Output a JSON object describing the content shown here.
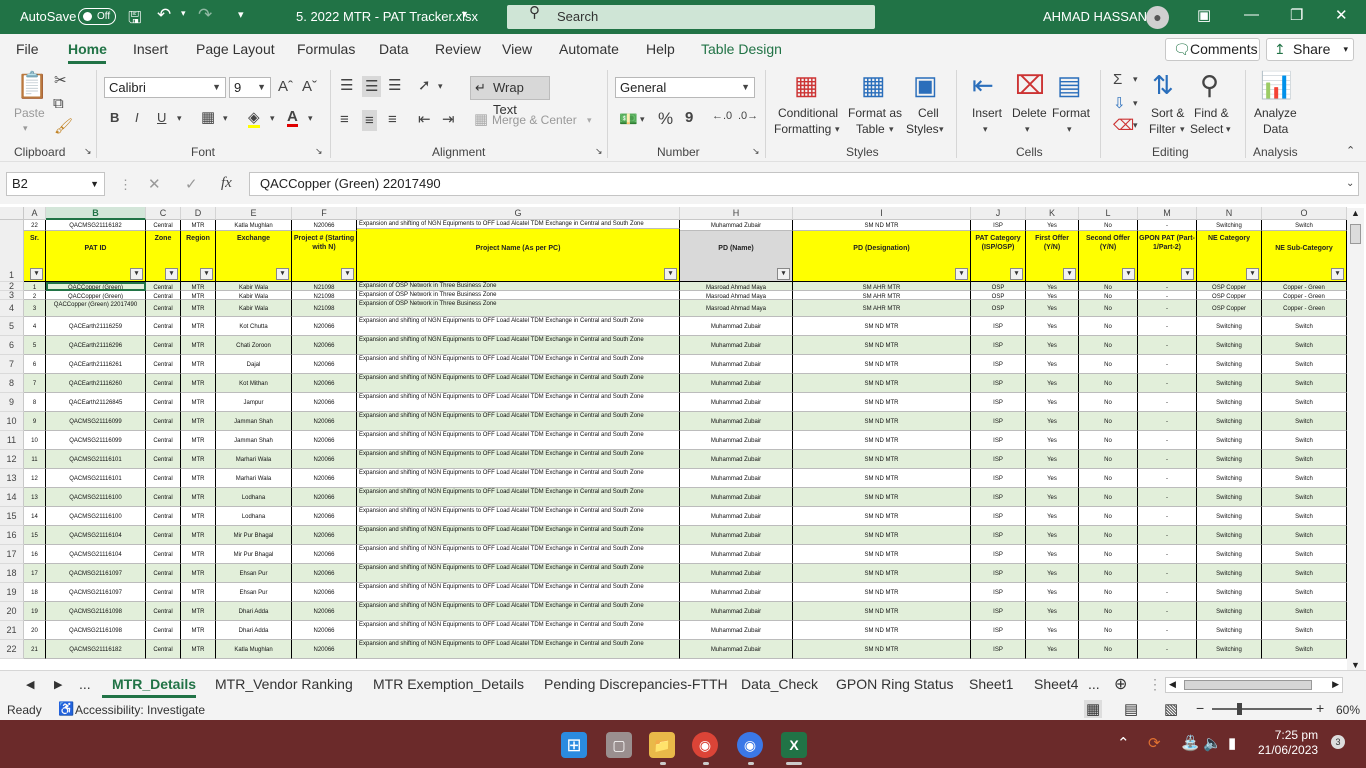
{
  "titlebar": {
    "autosave_label": "AutoSave",
    "autosave_state": "Off",
    "file_name": "5. 2022 MTR -  PAT Tracker.xlsx",
    "search_placeholder": "Search",
    "user_name": "AHMAD HASSAN"
  },
  "menu": {
    "items": [
      "File",
      "Home",
      "Insert",
      "Page Layout",
      "Formulas",
      "Data",
      "Review",
      "View",
      "Automate",
      "Help",
      "Table Design"
    ],
    "active": "Home",
    "comments_label": "Comments",
    "share_label": "Share"
  },
  "ribbon": {
    "clipboard": {
      "paste": "Paste",
      "group": "Clipboard"
    },
    "font": {
      "name": "Calibri",
      "size": "9",
      "group": "Font",
      "bold": "B",
      "italic": "I",
      "underline": "U"
    },
    "alignment": {
      "wrap": "Wrap Text",
      "merge": "Merge & Center",
      "group": "Alignment"
    },
    "number": {
      "format": "General",
      "group": "Number",
      "percent": "%",
      "comma": "9"
    },
    "styles": {
      "cond1": "Conditional",
      "cond2": "Formatting",
      "fmt1": "Format as",
      "fmt2": "Table",
      "cell1": "Cell",
      "cell2": "Styles",
      "group": "Styles"
    },
    "cells": {
      "insert": "Insert",
      "delete": "Delete",
      "format": "Format",
      "group": "Cells"
    },
    "editing": {
      "sort1": "Sort &",
      "sort2": "Filter",
      "find1": "Find &",
      "find2": "Select",
      "group": "Editing"
    },
    "analysis": {
      "a1": "Analyze",
      "a2": "Data",
      "group": "Analysis"
    }
  },
  "formula_bar": {
    "cell_ref": "B2",
    "formula": "QACCopper (Green) 22017490",
    "fx": "fx"
  },
  "columns": [
    {
      "letter": "A",
      "header": "Sr."
    },
    {
      "letter": "B",
      "header": "PAT ID"
    },
    {
      "letter": "C",
      "header": "Zone"
    },
    {
      "letter": "D",
      "header": "Region"
    },
    {
      "letter": "E",
      "header": "Exchange"
    },
    {
      "letter": "F",
      "header": "Project # (Starting with N)"
    },
    {
      "letter": "G",
      "header": "Project Name (As per PC)"
    },
    {
      "letter": "H",
      "header": "PD (Name)"
    },
    {
      "letter": "I",
      "header": "PD (Designation)"
    },
    {
      "letter": "J",
      "header": "PAT Category (ISP/OSP)"
    },
    {
      "letter": "K",
      "header": "First Offer (Y/N)"
    },
    {
      "letter": "L",
      "header": "Second Offer (Y/N)"
    },
    {
      "letter": "M",
      "header": "GPON PAT (Part-1/Part-2)"
    },
    {
      "letter": "N",
      "header": "NE Category"
    },
    {
      "letter": "O",
      "header": "NE Sub-Category"
    }
  ],
  "row_numbers": [
    "1",
    "2",
    "3",
    "4",
    "5",
    "6",
    "7",
    "8",
    "9",
    "10",
    "11",
    "12",
    "13",
    "14",
    "15",
    "16",
    "17",
    "18",
    "19",
    "20",
    "21",
    "22"
  ],
  "rows": [
    [
      "1",
      "QACCopper (Green)",
      "Central",
      "MTR",
      "Kabir Wala",
      "N21098",
      "Expansion of OSP Network in Three Business Zone",
      "Masroad Ahmad Maya",
      "SM AHR MTR",
      "OSP",
      "Yes",
      "No",
      "-",
      "OSP Copper",
      "Copper - Green"
    ],
    [
      "2",
      "QACCopper (Green)",
      "Central",
      "MTR",
      "Kabir Wala",
      "N21098",
      "Expansion of OSP Network in Three Business Zone",
      "Masroad Ahmad Maya",
      "SM AHR MTR",
      "OSP",
      "Yes",
      "No",
      "-",
      "OSP Copper",
      "Copper - Green"
    ],
    [
      "3",
      "QACCopper (Green) 22017490",
      "Central",
      "MTR",
      "Kabir Wala",
      "N21098",
      "Expansion of OSP Network in Three Business Zone",
      "Masroad Ahmad Maya",
      "SM AHR MTR",
      "OSP",
      "Yes",
      "No",
      "-",
      "OSP Copper",
      "Copper - Green"
    ],
    [
      "4",
      "QACEarth21116259",
      "Central",
      "MTR",
      "Kot Chutta",
      "N20066",
      "Expansion and shifting of NGN Equipments to OFF Load Alcatel TDM Exchange in Central and South Zone",
      "Muhammad Zubair",
      "SM ND MTR",
      "ISP",
      "Yes",
      "No",
      "-",
      "Switching",
      "Switch"
    ],
    [
      "5",
      "QACEarth21116296",
      "Central",
      "MTR",
      "Chati Zoroon",
      "N20066",
      "Expansion and shifting of NGN Equipments to OFF Load Alcatel TDM Exchange in Central and South Zone",
      "Muhammad Zubair",
      "SM ND MTR",
      "ISP",
      "Yes",
      "No",
      "-",
      "Switching",
      "Switch"
    ],
    [
      "6",
      "QACEarth21116261",
      "Central",
      "MTR",
      "Dajal",
      "N20066",
      "Expansion and shifting of NGN Equipments to OFF Load Alcatel TDM Exchange in Central and South Zone",
      "Muhammad Zubair",
      "SM ND MTR",
      "ISP",
      "Yes",
      "No",
      "-",
      "Switching",
      "Switch"
    ],
    [
      "7",
      "QACEarth21116260",
      "Central",
      "MTR",
      "Kot Mithan",
      "N20066",
      "Expansion and shifting of NGN Equipments to OFF Load Alcatel TDM Exchange in Central and South Zone",
      "Muhammad Zubair",
      "SM ND MTR",
      "ISP",
      "Yes",
      "No",
      "-",
      "Switching",
      "Switch"
    ],
    [
      "8",
      "QACEarth21126845",
      "Central",
      "MTR",
      "Jampur",
      "N20066",
      "Expansion and shifting of NGN Equipments to OFF Load Alcatel TDM Exchange in Central and South Zone",
      "Muhammad Zubair",
      "SM ND MTR",
      "ISP",
      "Yes",
      "No",
      "-",
      "Switching",
      "Switch"
    ],
    [
      "9",
      "QACMSG21116099",
      "Central",
      "MTR",
      "Jamman Shah",
      "N20066",
      "Expansion and shifting of NGN Equipments to OFF Load Alcatel TDM Exchange in Central and South Zone",
      "Muhammad Zubair",
      "SM ND MTR",
      "ISP",
      "Yes",
      "No",
      "-",
      "Switching",
      "Switch"
    ],
    [
      "10",
      "QACMSG21116099",
      "Central",
      "MTR",
      "Jamman Shah",
      "N20066",
      "Expansion and shifting of NGN Equipments to OFF Load Alcatel TDM Exchange in Central and South Zone",
      "Muhammad Zubair",
      "SM ND MTR",
      "ISP",
      "Yes",
      "No",
      "-",
      "Switching",
      "Switch"
    ],
    [
      "11",
      "QACMSG21116101",
      "Central",
      "MTR",
      "Marhari Wala",
      "N20066",
      "Expansion and shifting of NGN Equipments to OFF Load Alcatel TDM Exchange in Central and South Zone",
      "Muhammad Zubair",
      "SM ND MTR",
      "ISP",
      "Yes",
      "No",
      "-",
      "Switching",
      "Switch"
    ],
    [
      "12",
      "QACMSG21116101",
      "Central",
      "MTR",
      "Marhari Wala",
      "N20066",
      "Expansion and shifting of NGN Equipments to OFF Load Alcatel TDM Exchange in Central and South Zone",
      "Muhammad Zubair",
      "SM ND MTR",
      "ISP",
      "Yes",
      "No",
      "-",
      "Switching",
      "Switch"
    ],
    [
      "13",
      "QACMSG21116100",
      "Central",
      "MTR",
      "Lodhana",
      "N20066",
      "Expansion and shifting of NGN Equipments to OFF Load Alcatel TDM Exchange in Central and South Zone",
      "Muhammad Zubair",
      "SM ND MTR",
      "ISP",
      "Yes",
      "No",
      "-",
      "Switching",
      "Switch"
    ],
    [
      "14",
      "QACMSG21116100",
      "Central",
      "MTR",
      "Lodhana",
      "N20066",
      "Expansion and shifting of NGN Equipments to OFF Load Alcatel TDM Exchange in Central and South Zone",
      "Muhammad Zubair",
      "SM ND MTR",
      "ISP",
      "Yes",
      "No",
      "-",
      "Switching",
      "Switch"
    ],
    [
      "15",
      "QACMSG21116104",
      "Central",
      "MTR",
      "Mir Pur Bhagal",
      "N20066",
      "Expansion and shifting of NGN Equipments to OFF Load Alcatel TDM Exchange in Central and South Zone",
      "Muhammad Zubair",
      "SM ND MTR",
      "ISP",
      "Yes",
      "No",
      "-",
      "Switching",
      "Switch"
    ],
    [
      "16",
      "QACMSG21116104",
      "Central",
      "MTR",
      "Mir Pur Bhagal",
      "N20066",
      "Expansion and shifting of NGN Equipments to OFF Load Alcatel TDM Exchange in Central and South Zone",
      "Muhammad Zubair",
      "SM ND MTR",
      "ISP",
      "Yes",
      "No",
      "-",
      "Switching",
      "Switch"
    ],
    [
      "17",
      "QACMSG21161097",
      "Central",
      "MTR",
      "Ehsan Pur",
      "N20066",
      "Expansion and shifting of NGN Equipments to OFF Load Alcatel TDM Exchange in Central and South Zone",
      "Muhammad Zubair",
      "SM ND MTR",
      "ISP",
      "Yes",
      "No",
      "-",
      "Switching",
      "Switch"
    ],
    [
      "18",
      "QACMSG21161097",
      "Central",
      "MTR",
      "Ehsan Pur",
      "N20066",
      "Expansion and shifting of NGN Equipments to OFF Load Alcatel TDM Exchange in Central and South Zone",
      "Muhammad Zubair",
      "SM ND MTR",
      "ISP",
      "Yes",
      "No",
      "-",
      "Switching",
      "Switch"
    ],
    [
      "19",
      "QACMSG21161098",
      "Central",
      "MTR",
      "Dhari Adda",
      "N20066",
      "Expansion and shifting of NGN Equipments to OFF Load Alcatel TDM Exchange in Central and South Zone",
      "Muhammad Zubair",
      "SM ND MTR",
      "ISP",
      "Yes",
      "No",
      "-",
      "Switching",
      "Switch"
    ],
    [
      "20",
      "QACMSG21161098",
      "Central",
      "MTR",
      "Dhari Adda",
      "N20066",
      "Expansion and shifting of NGN Equipments to OFF Load Alcatel TDM Exchange in Central and South Zone",
      "Muhammad Zubair",
      "SM ND MTR",
      "ISP",
      "Yes",
      "No",
      "-",
      "Switching",
      "Switch"
    ],
    [
      "21",
      "QACMSG21116182",
      "Central",
      "MTR",
      "Katla Mughlan",
      "N20066",
      "Expansion and shifting of NGN Equipments to OFF Load Alcatel TDM Exchange in Central and South Zone",
      "Muhammad Zubair",
      "SM ND MTR",
      "ISP",
      "Yes",
      "No",
      "-",
      "Switching",
      "Switch"
    ],
    [
      "22",
      "QACMSG21116182",
      "Central",
      "MTR",
      "Katla Mughlan",
      "N20066",
      "Expansion and shifting of NGN Equipments to OFF Load Alcatel TDM Exchange in Central and South Zone",
      "Muhammad Zubair",
      "SM ND MTR",
      "ISP",
      "Yes",
      "No",
      "-",
      "Switching",
      "Switch"
    ]
  ],
  "sheet_tabs": {
    "items": [
      "MTR_Details",
      "MTR_Vendor Ranking",
      "MTR Exemption_Details",
      "Pending Discrepancies-FTTH",
      "Data_Check",
      "GPON Ring Status",
      "Sheet1",
      "Sheet4"
    ],
    "active": "MTR_Details",
    "ellipsis": "..."
  },
  "status": {
    "ready": "Ready",
    "accessibility": "Accessibility: Investigate",
    "zoom": "60%"
  },
  "taskbar": {
    "time": "7:25 pm",
    "date": "21/06/2023",
    "notifications": "3"
  },
  "colors": {
    "excel_green": "#217346",
    "header_yellow": "#ffff00",
    "band_green": "#e2efda",
    "taskbar": "#6b2a2a"
  }
}
